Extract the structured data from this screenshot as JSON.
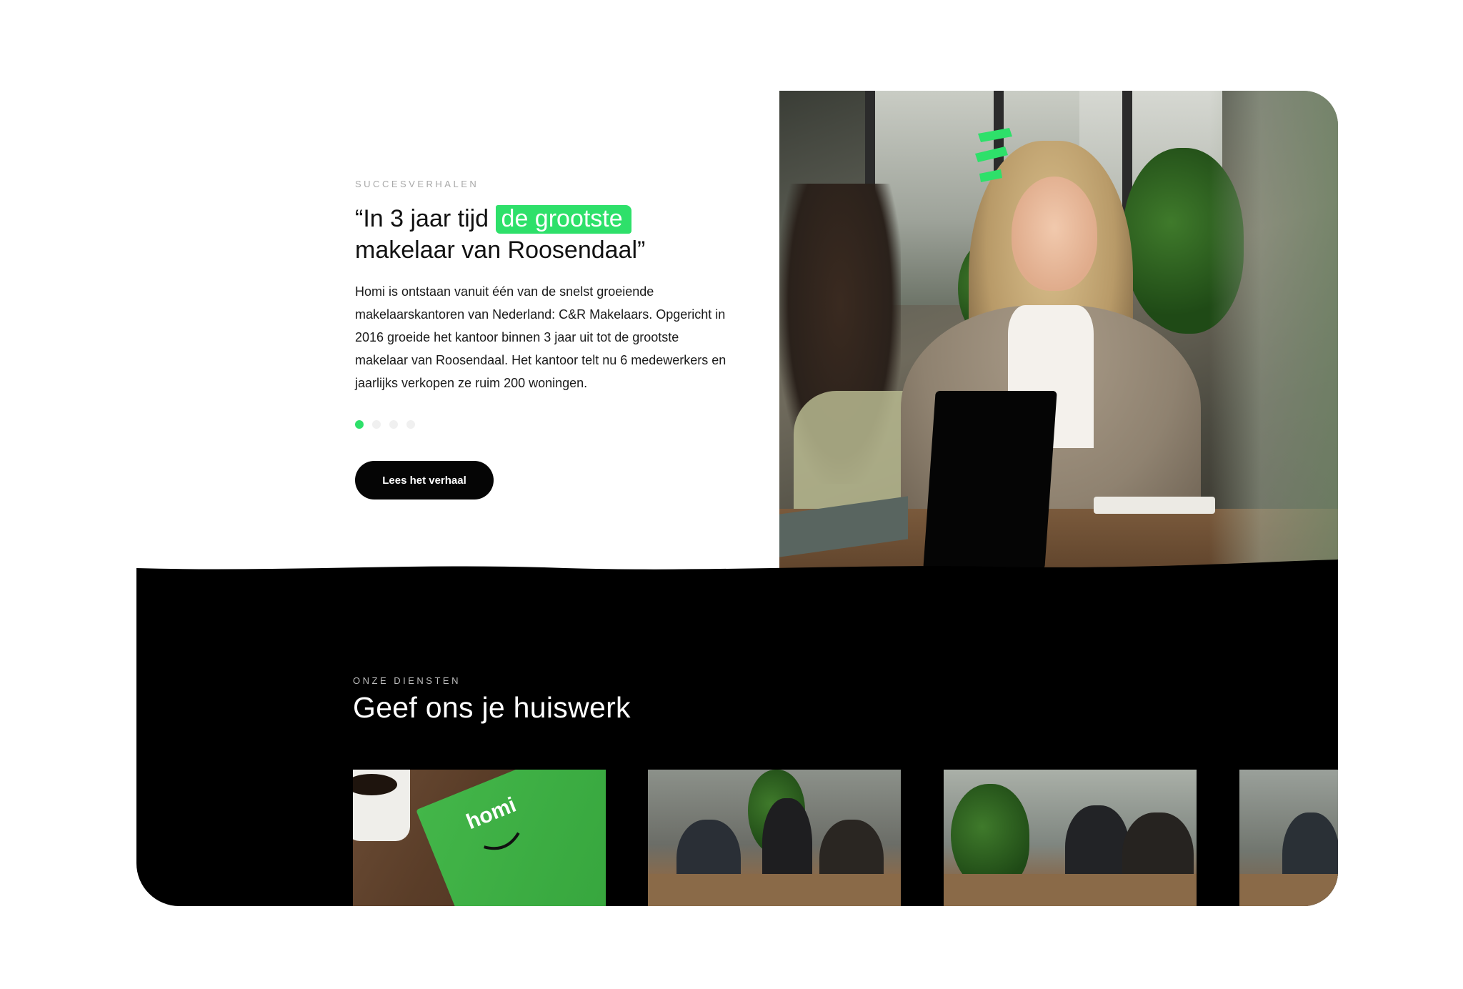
{
  "story": {
    "eyebrow": "SUCCESVERHALEN",
    "quote_before": "“In 3 jaar tijd",
    "quote_highlight": "de grootste",
    "quote_after": "makelaar van Roosendaal”",
    "body": "Homi is ontstaan vanuit één van de snelst groeiende makelaarskantoren van Nederland: C&R Makelaars. Opgericht in 2016 groeide het kantoor binnen 3 jaar uit tot de grootste makelaar van Roosendaal. Het kantoor telt nu 6 medewerkers en jaarlijks verkopen ze ruim 200 woningen.",
    "carousel": {
      "count": 4,
      "active": 1
    },
    "cta_label": "Lees het verhaal"
  },
  "services": {
    "eyebrow": "ONZE DIENSTEN",
    "title": "Geef ons je huiswerk",
    "thumb_logo_text": "homi"
  },
  "colors": {
    "accent": "#2ee06a",
    "dark_bg": "#000000",
    "button_bg": "#050505"
  }
}
